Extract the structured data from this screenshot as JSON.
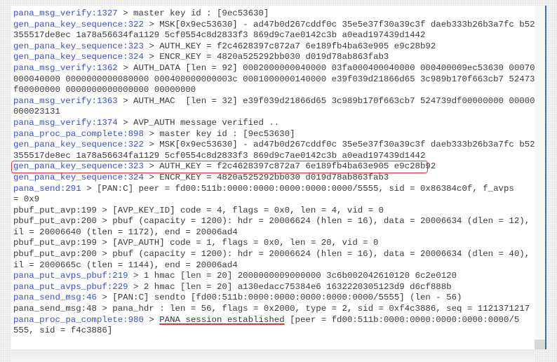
{
  "log": {
    "lines": [
      {
        "fn": "pana_msg_verify:1327",
        "text": " > master key id : [9ec53630]"
      },
      {
        "fn": "gen_pana_key_sequence:322",
        "text": " > MSK[0x9ec53630] - ad47b0d267cddf0c 35e5e37f30a39c3f daeb333b26b3a7fc b52d8"
      },
      {
        "fn": "",
        "text": "355517de8ec 1a78a56634fa1129 5cf0554c8d2833f3 869d9c7ae0142c3b a0ead197439d1442"
      },
      {
        "fn": "gen_pana_key_sequence:323",
        "text": " > AUTH_KEY = f2c4628397c872a7 6e189fb4ba63e905 e9c28b92"
      },
      {
        "fn": "gen_pana_key_sequence:324",
        "text": " > ENCR_KEY = 4820a525292bb030 d019d78ab863fab3"
      },
      {
        "fn": "pana_msg_verify:1362",
        "text": " > AUTH_DATA [len = 92] 0002000000040000 03fa000400040000 000400009ec53630 0007000"
      },
      {
        "fn": "",
        "text": "000040000 0000000000080000 000400000000003c 0001000000140000 e39f039d21866d65 3c989b170f663cb7 524739d"
      },
      {
        "fn": "",
        "text": "f00000000 0000000000000000 00000000"
      },
      {
        "fn": "pana_msg_verify:1363",
        "text": " > AUTH_MAC  [len = 32] e39f039d21866d65 3c989b170f663cb7 524739df00000000 0000002"
      },
      {
        "fn": "",
        "text": "000023131"
      },
      {
        "fn": "pana_msg_verify:1374",
        "text": " > AVP_AUTH message verified .."
      },
      {
        "fn": "pana_proc_pa_complete:898",
        "text": " > master key id : [9ec53630]"
      },
      {
        "fn": "gen_pana_key_sequence:322",
        "text": " > MSK[0x9ec53630] - ad47b0d267cddf0c 35e5e37f30a39c3f daeb333b26b3a7fc b52d8"
      },
      {
        "fn": "",
        "text": "355517de8ec 1a78a56634fa1129 5cf0554c8d2833f3 869d9c7ae0142c3b a0ead197439d1442"
      },
      {
        "fn": "gen_pana_key_sequence:323",
        "text": " > AUTH_KEY = f2c4628397c872a7 6e189fb4ba63e905 e9c28b92",
        "highlight": "box"
      },
      {
        "fn": "gen_pana_key_sequence:324",
        "text": " > ENCR_KEY = 4820a525292bb030 d019d78ab863fab3"
      },
      {
        "fn": "pana_send:291",
        "text": " > [PAN:C] peer = fd00:511b:0000:0000:0000:0000:0000/5555, sid = 0x86384c0f, f_avps"
      },
      {
        "fn": "",
        "text": "= 0x9"
      },
      {
        "fn": "",
        "text": "pbuf_put_avp:199 > [AVP_KEY_ID] code = 4, flags = 0x0, len = 4, vid = 0"
      },
      {
        "fn": "",
        "text": "pbuf_put_avp:200 > pbuf (capacity = 1200): hdr = 20006624 (hlen = 16), data = 20006634 (dlen = 12), ta"
      },
      {
        "fn": "",
        "text": "il = 20006640 (tlen = 1172), end = 20006ad4"
      },
      {
        "fn": "",
        "text": "pbuf_put_avp:199 > [AVP_AUTH] code = 1, flags = 0x0, len = 20, vid = 0"
      },
      {
        "fn": "",
        "text": "pbuf_put_avp:200 > pbuf (capacity = 1200): hdr = 20006624 (hlen = 16), data = 20006634 (dlen = 40), ta"
      },
      {
        "fn": "",
        "text": "il = 2000665c (tlen = 1144), end = 20006ad4"
      },
      {
        "fn": "pana_put_avps_pbuf:219",
        "text": " > 1 hmac [len = 20] 2000000009000000 3c6b002042610120 6c2e0120"
      },
      {
        "fn": "pana_put_avps_pbuf:229",
        "text": " > 2 hmac [len = 20] a130edacc75384e6 1632220305123d9 d6cf888b"
      },
      {
        "fn": "pana_send_msg:46",
        "text": " > [PAN:C] sendto [fd00:511b:0000:0000:0000:0000:0000/5555] (len - 56)"
      },
      {
        "fn": "",
        "text": "pana_send_msg:48 > pana_hdr : len = 56, flags = 0x2000, type = 2, sid = 0xf4c3886, seq = 1121371217"
      },
      {
        "fn": "pana_proc_pa_complete:980",
        "text": " > ",
        "underlined": "PANA session established",
        "rest": " [peer = fd00:511b:0000:0000:0000:0000:0000/5"
      },
      {
        "fn": "",
        "text": "555, sid = f4c3886]"
      }
    ]
  },
  "colors": {
    "function_name": "#3b4fd8",
    "text": "#3a3a3a",
    "highlight": "#e8303a"
  }
}
